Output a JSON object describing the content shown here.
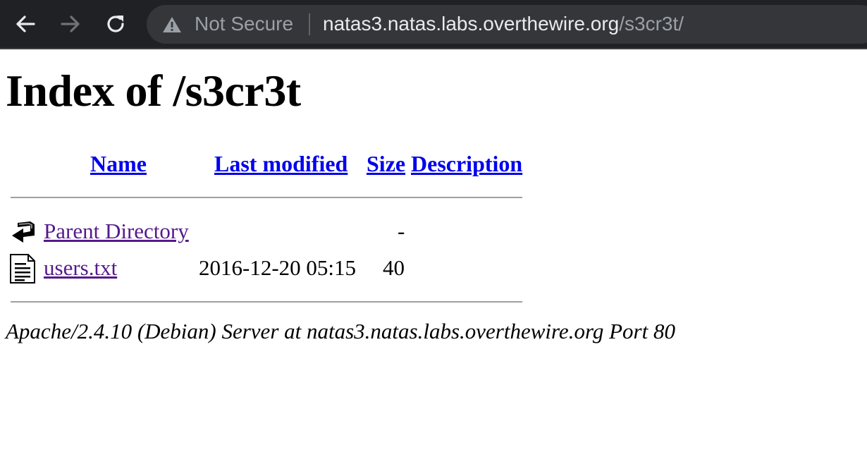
{
  "browser": {
    "security_label": "Not Secure",
    "url_host": "natas3.natas.labs.overthewire.org",
    "url_path": "/s3cr3t/"
  },
  "page": {
    "title": "Index of /s3cr3t",
    "columns": {
      "name": "Name",
      "last_modified": "Last modified",
      "size": "Size",
      "description": "Description"
    },
    "rows": [
      {
        "icon": "back-icon",
        "name": "Parent Directory",
        "last_modified": "",
        "size": "-",
        "description": ""
      },
      {
        "icon": "text-file-icon",
        "name": "users.txt",
        "last_modified": "2016-12-20 05:15",
        "size": "40",
        "description": ""
      }
    ],
    "footer": "Apache/2.4.10 (Debian) Server at natas3.natas.labs.overthewire.org Port 80"
  }
}
